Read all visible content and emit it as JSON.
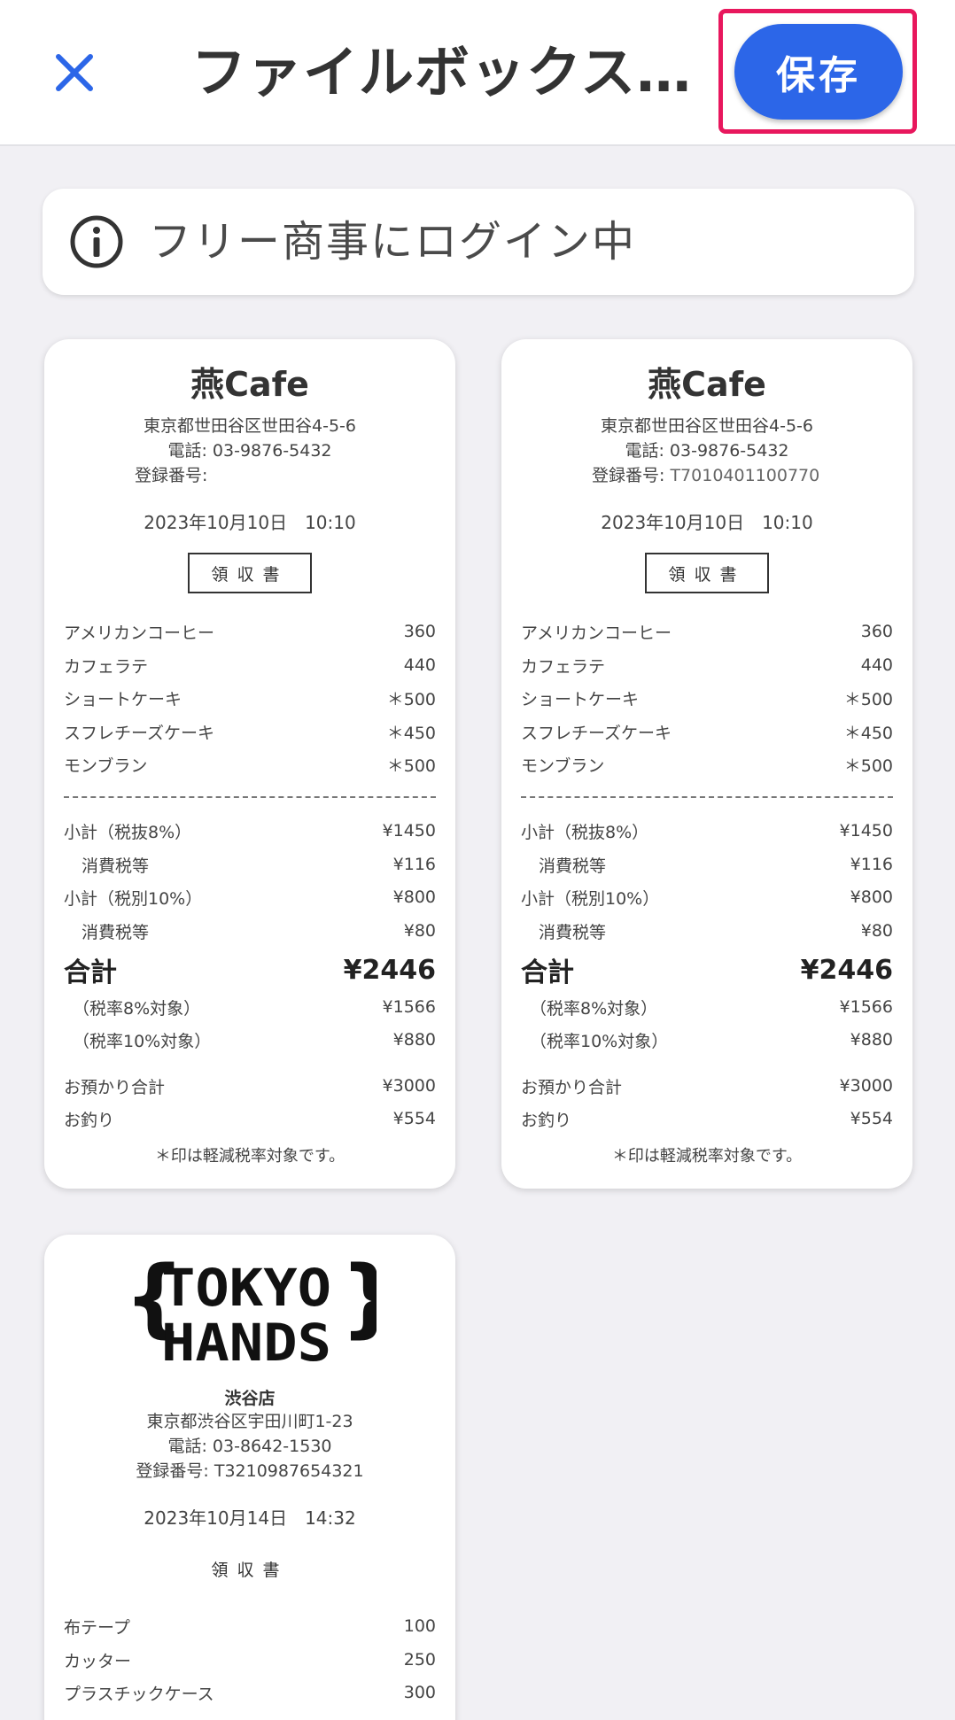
{
  "header": {
    "title": "ファイルボックスに…",
    "save_label": "保存"
  },
  "banner": {
    "text": "フリー商事にログイン中"
  },
  "receipts": [
    {
      "shop": "燕Cafe",
      "address": "東京都世田谷区世田谷4-5-6",
      "phone": "電話: 03-9876-5432",
      "reg_label": "登録番号:",
      "reg_number": "",
      "datetime": "2023年10月10日　10:10",
      "doc_label": "領収書",
      "items": [
        {
          "name": "アメリカンコーヒー",
          "price": "360"
        },
        {
          "name": "カフェラテ",
          "price": "440"
        },
        {
          "name": "ショートケーキ",
          "price": "＊500"
        },
        {
          "name": "スフレチーズケーキ",
          "price": "＊450"
        },
        {
          "name": "モンブラン",
          "price": "＊500"
        }
      ],
      "summary": [
        {
          "name": "小計（税抜8%）",
          "price": "¥1450"
        },
        {
          "name": "消費税等",
          "price": "¥116"
        },
        {
          "name": "小計（税別10%）",
          "price": "¥800"
        },
        {
          "name": "消費税等",
          "price": "¥80"
        }
      ],
      "total_label": "合計",
      "total_value": "¥2446",
      "breakdown": [
        {
          "name": "（税率8%対象）",
          "price": "¥1566"
        },
        {
          "name": "（税率10%対象）",
          "price": "¥880"
        }
      ],
      "payment": [
        {
          "name": "お預かり合計",
          "price": "¥3000"
        },
        {
          "name": "お釣り",
          "price": "¥554"
        }
      ],
      "note": "＊印は軽減税率対象です。"
    },
    {
      "shop": "燕Cafe",
      "address": "東京都世田谷区世田谷4-5-6",
      "phone": "電話: 03-9876-5432",
      "reg_label": "登録番号:",
      "reg_number": "T7010401100770",
      "datetime": "2023年10月10日　10:10",
      "doc_label": "領収書",
      "items": [
        {
          "name": "アメリカンコーヒー",
          "price": "360"
        },
        {
          "name": "カフェラテ",
          "price": "440"
        },
        {
          "name": "ショートケーキ",
          "price": "＊500"
        },
        {
          "name": "スフレチーズケーキ",
          "price": "＊450"
        },
        {
          "name": "モンブラン",
          "price": "＊500"
        }
      ],
      "summary": [
        {
          "name": "小計（税抜8%）",
          "price": "¥1450"
        },
        {
          "name": "消費税等",
          "price": "¥116"
        },
        {
          "name": "小計（税別10%）",
          "price": "¥800"
        },
        {
          "name": "消費税等",
          "price": "¥80"
        }
      ],
      "total_label": "合計",
      "total_value": "¥2446",
      "breakdown": [
        {
          "name": "（税率8%対象）",
          "price": "¥1566"
        },
        {
          "name": "（税率10%対象）",
          "price": "¥880"
        }
      ],
      "payment": [
        {
          "name": "お預かり合計",
          "price": "¥3000"
        },
        {
          "name": "お釣り",
          "price": "¥554"
        }
      ],
      "note": "＊印は軽減税率対象です。"
    },
    {
      "logo_line1": "TOKYO",
      "logo_line2": "HANDS",
      "branch": "渋谷店",
      "address": "東京都渋谷区宇田川町1-23",
      "phone": "電話: 03-8642-1530",
      "reg": "登録番号: T3210987654321",
      "datetime": "2023年10月14日　14:32",
      "doc_label": "領収書",
      "items": [
        {
          "name": "布テープ",
          "price": "100"
        },
        {
          "name": "カッター",
          "price": "250"
        },
        {
          "name": "プラスチックケース",
          "price": "300"
        }
      ]
    }
  ],
  "colors": {
    "accent": "#2c66e8",
    "highlight": "#e8175d",
    "background": "#f1f0f4"
  },
  "icons": {
    "close": "close-icon",
    "info": "info-icon"
  }
}
